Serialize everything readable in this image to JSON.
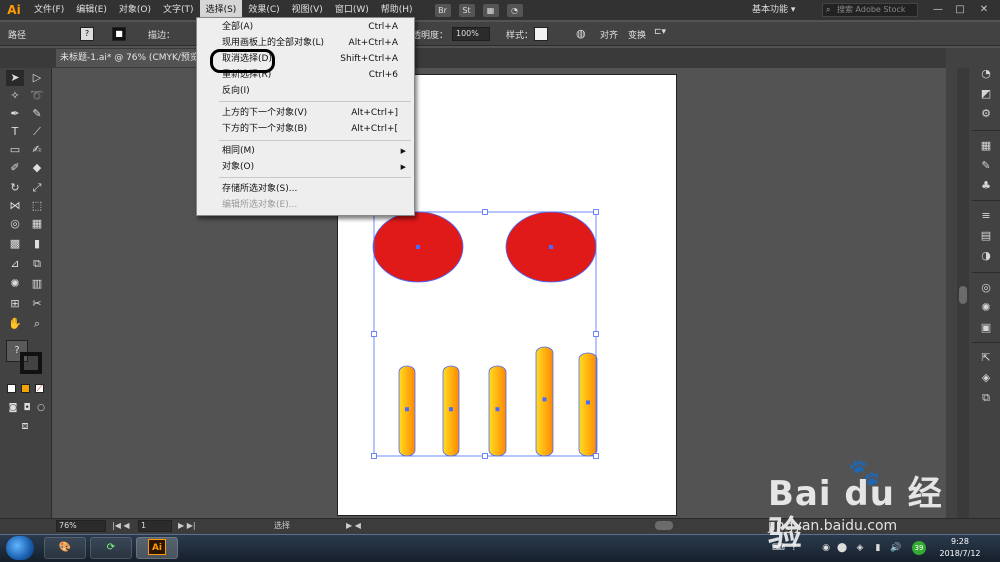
{
  "menubar": {
    "logo": "Ai",
    "items": [
      "文件(F)",
      "编辑(E)",
      "对象(O)",
      "文字(T)",
      "选择(S)",
      "效果(C)",
      "视图(V)",
      "窗口(W)",
      "帮助(H)"
    ],
    "icons": [
      "Br",
      "St"
    ],
    "workspace": "基本功能",
    "search_placeholder": "搜索 Adobe Stock"
  },
  "control_bar": {
    "path_label": "路径",
    "stroke_label": "描边：",
    "opacity_label": "透明度：",
    "opacity_value": "100%",
    "style_label": "样式：",
    "align_label": "对齐",
    "transform_label": "变换"
  },
  "document_tab": {
    "title": "未标题-1.ai* @ 76% (CMYK/预览)"
  },
  "select_menu": {
    "items": [
      {
        "label": "全部(A)",
        "shortcut": "Ctrl+A"
      },
      {
        "label": "现用画板上的全部对象(L)",
        "shortcut": "Alt+Ctrl+A"
      },
      {
        "label": "取消选择(D)",
        "shortcut": "Shift+Ctrl+A"
      },
      {
        "label": "重新选择(R)",
        "shortcut": "Ctrl+6"
      },
      {
        "label": "反向(I)",
        "shortcut": ""
      },
      {
        "label": "上方的下一个对象(V)",
        "shortcut": "Alt+Ctrl+]"
      },
      {
        "label": "下方的下一个对象(B)",
        "shortcut": "Alt+Ctrl+["
      },
      {
        "label": "相同(M)",
        "shortcut": "",
        "submenu": true
      },
      {
        "label": "对象(O)",
        "shortcut": "",
        "submenu": true
      },
      {
        "label": "存储所选对象(S)...",
        "shortcut": ""
      },
      {
        "label": "编辑所选对象(E)...",
        "shortcut": "",
        "disabled": true
      }
    ]
  },
  "tools_panel": {
    "help_glyph": "?",
    "tools": [
      "selection-tool",
      "direct-selection-tool",
      "magic-wand-tool",
      "lasso-tool",
      "pen-tool",
      "curvature-tool",
      "type-tool",
      "line-tool",
      "rectangle-tool",
      "paintbrush-tool",
      "shaper-tool",
      "eraser-tool",
      "rotate-tool",
      "scale-tool",
      "width-tool",
      "free-transform-tool",
      "shape-builder-tool",
      "perspective-grid-tool",
      "mesh-tool",
      "gradient-tool",
      "eyedropper-tool",
      "blend-tool",
      "symbol-sprayer-tool",
      "column-graph-tool",
      "artboard-tool",
      "slice-tool",
      "hand-tool",
      "zoom-tool"
    ]
  },
  "status_bar": {
    "zoom": "76%",
    "artboard_number": "1",
    "status_text": "选择"
  },
  "taskbar": {
    "ai_label": "Ai",
    "badge": "39",
    "time": "9:28",
    "date": "2018/7/12"
  },
  "watermark": {
    "brand": "Bai du 经验",
    "url": "jingyan.baidu.com"
  },
  "colors": {
    "ellipse_fill": "#e01919",
    "bar_gradient_start": "#ffdd22",
    "bar_gradient_end": "#ff8800",
    "selection": "#4a6bff"
  }
}
